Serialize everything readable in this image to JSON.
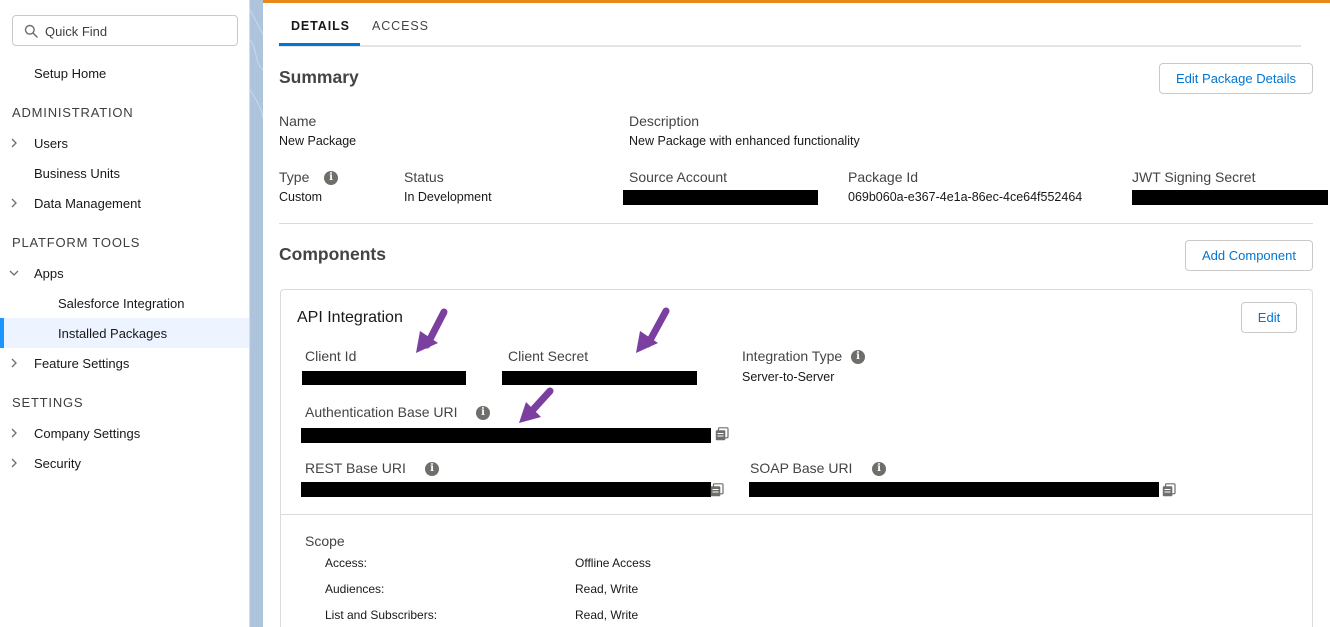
{
  "sidebar": {
    "search_placeholder": "Quick Find",
    "setup_home": "Setup Home",
    "sections": {
      "administration": "ADMINISTRATION",
      "platform_tools": "PLATFORM TOOLS",
      "settings": "SETTINGS"
    },
    "items": {
      "users": "Users",
      "business_units": "Business Units",
      "data_management": "Data Management",
      "apps": "Apps",
      "salesforce_integration": "Salesforce Integration",
      "installed_packages": "Installed Packages",
      "feature_settings": "Feature Settings",
      "company_settings": "Company Settings",
      "security": "Security"
    }
  },
  "tabs": {
    "details": "DETAILS",
    "access": "ACCESS"
  },
  "summary": {
    "title": "Summary",
    "edit_button": "Edit Package Details",
    "name_label": "Name",
    "name_value": "New Package",
    "description_label": "Description",
    "description_value": "New Package with enhanced functionality",
    "type_label": "Type",
    "type_value": "Custom",
    "status_label": "Status",
    "status_value": "In Development",
    "source_account_label": "Source Account",
    "package_id_label": "Package Id",
    "package_id_value": "069b060a-e367-4e1a-86ec-4ce64f552464",
    "jwt_label": "JWT Signing Secret"
  },
  "components": {
    "title": "Components",
    "add_button": "Add Component",
    "card": {
      "title": "API Integration",
      "edit_button": "Edit",
      "client_id_label": "Client Id",
      "client_secret_label": "Client Secret",
      "integration_type_label": "Integration Type",
      "integration_type_value": "Server-to-Server",
      "auth_uri_label": "Authentication Base URI",
      "rest_uri_label": "REST Base URI",
      "soap_uri_label": "SOAP Base URI",
      "scope": {
        "title": "Scope",
        "rows": [
          {
            "label": "Access:",
            "value": "Offline Access"
          },
          {
            "label": "Audiences:",
            "value": "Read, Write"
          },
          {
            "label": "List and Subscribers:",
            "value": "Read, Write"
          }
        ]
      }
    }
  },
  "colors": {
    "accent_orange": "#e8891a",
    "link_blue": "#0176d3",
    "arrow_purple": "#7b3fa0"
  },
  "icons": [
    "search-icon",
    "chevron-right-icon",
    "chevron-down-icon",
    "info-icon",
    "copy-icon",
    "arrow-annotation"
  ]
}
